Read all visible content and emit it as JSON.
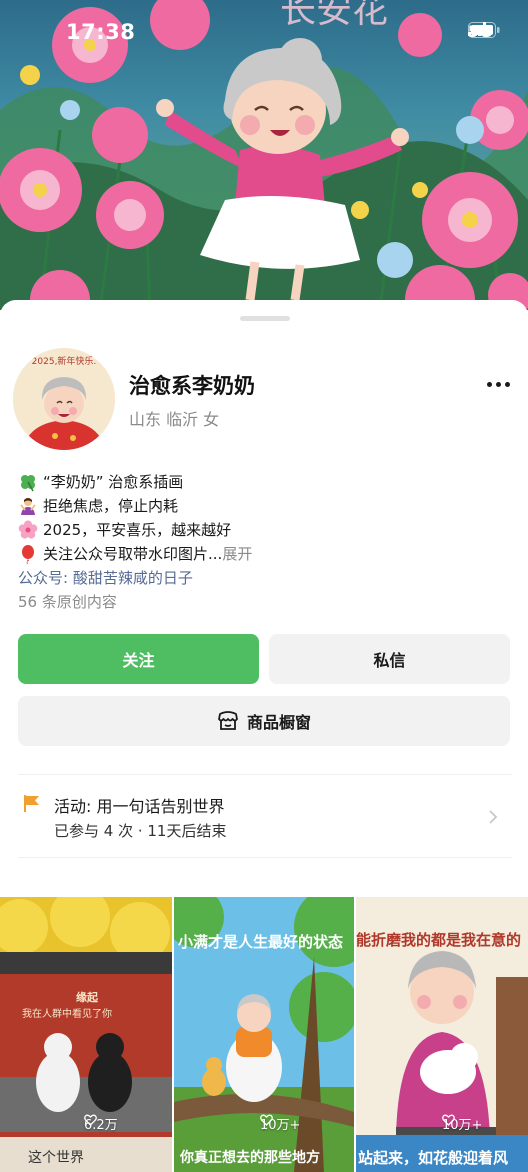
{
  "status_bar": {
    "time": "17:38",
    "network": "5G"
  },
  "cover": {
    "painted_text": "长安花"
  },
  "profile": {
    "name": "治愈系李奶奶",
    "location": "山东 临沂 女",
    "avatar_text": "2025,新年快乐."
  },
  "bio": {
    "lines": [
      {
        "icon": "clover-icon",
        "text": "“李奶奶” 治愈系插画"
      },
      {
        "icon": "person-gesture-icon",
        "text": "拒绝焦虑，停止内耗"
      },
      {
        "icon": "cherry-blossom-icon",
        "text": "2025，平安喜乐，越来越好"
      },
      {
        "icon": "balloon-icon",
        "text": "关注公众号取带水印图片...",
        "expand": "展开"
      }
    ],
    "official_account": "公众号: 酸甜苦辣咸的日子",
    "original_count": "56 条原创内容"
  },
  "buttons": {
    "follow": "关注",
    "message": "私信",
    "shop": "商品橱窗"
  },
  "activity": {
    "title": "活动: 用一句话告别世界",
    "subtitle": "已参与 4 次 · 11天后结束"
  },
  "grid": [
    {
      "caption": "缘起",
      "poem": "我在人群中看见了你",
      "likes": "6.2万",
      "bottom": "这个世界"
    },
    {
      "caption": "小满才是人生最好的状态",
      "likes": "10万+",
      "bottom": "你真正想去的那些地方"
    },
    {
      "caption": "能折磨我的都是我在意的",
      "likes": "10万+",
      "bottom": "站起来，如花般迎着风"
    }
  ],
  "colors": {
    "accent": "#4fbe63",
    "link": "#576b95",
    "muted": "#8a8a8a"
  }
}
